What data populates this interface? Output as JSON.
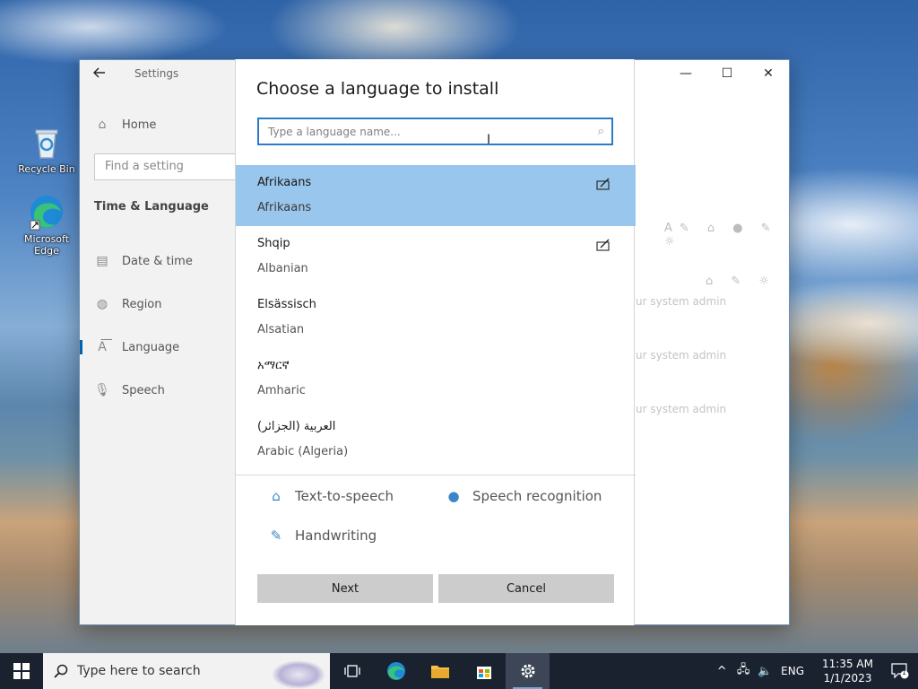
{
  "desktop": {
    "icons": [
      {
        "label": "Recycle Bin",
        "icon": "recycle-bin-icon"
      },
      {
        "label": "Microsoft Edge",
        "icon": "edge-icon"
      }
    ]
  },
  "settings_window": {
    "title": "Settings",
    "back_icon": "back-arrow-icon",
    "controls": {
      "minimize": "—",
      "maximize": "☐",
      "close": "✕"
    },
    "search_placeholder": "Find a setting",
    "home_label": "Home",
    "section_heading": "Time & Language",
    "nav_items": [
      {
        "label": "Date & time",
        "icon": "calendar-clock-icon"
      },
      {
        "label": "Region",
        "icon": "globe-icon"
      },
      {
        "label": "Language",
        "icon": "language-icon",
        "active": true
      },
      {
        "label": "Speech",
        "icon": "microphone-icon"
      }
    ],
    "background_text": [
      "ur system admin",
      "ur system admin",
      "ur system admin"
    ]
  },
  "dialog": {
    "title": "Choose a language to install",
    "search_placeholder": "Type a language name...",
    "languages": [
      {
        "native": "Afrikaans",
        "english": "Afrikaans",
        "handwriting": true,
        "selected": true
      },
      {
        "native": "Shqip",
        "english": "Albanian",
        "handwriting": true,
        "selected": false
      },
      {
        "native": "Elsässisch",
        "english": "Alsatian",
        "handwriting": false,
        "selected": false
      },
      {
        "native": "አማርኛ",
        "english": "Amharic",
        "handwriting": false,
        "selected": false
      },
      {
        "native": "العربية (الجزائر)",
        "english": "Arabic (Algeria)",
        "handwriting": false,
        "selected": false
      }
    ],
    "features": {
      "text_to_speech": "Text-to-speech",
      "speech_recognition": "Speech recognition",
      "handwriting": "Handwriting"
    },
    "buttons": {
      "next": "Next",
      "cancel": "Cancel"
    },
    "accent_color": "#99c6ec"
  },
  "taskbar": {
    "search_placeholder": "Type here to search",
    "apps": [
      "task-view-icon",
      "edge-icon",
      "file-explorer-icon",
      "store-icon",
      "settings-gear-icon"
    ],
    "language": "ENG",
    "time": "11:35 AM",
    "date": "1/1/2023",
    "notification_count": "1"
  }
}
